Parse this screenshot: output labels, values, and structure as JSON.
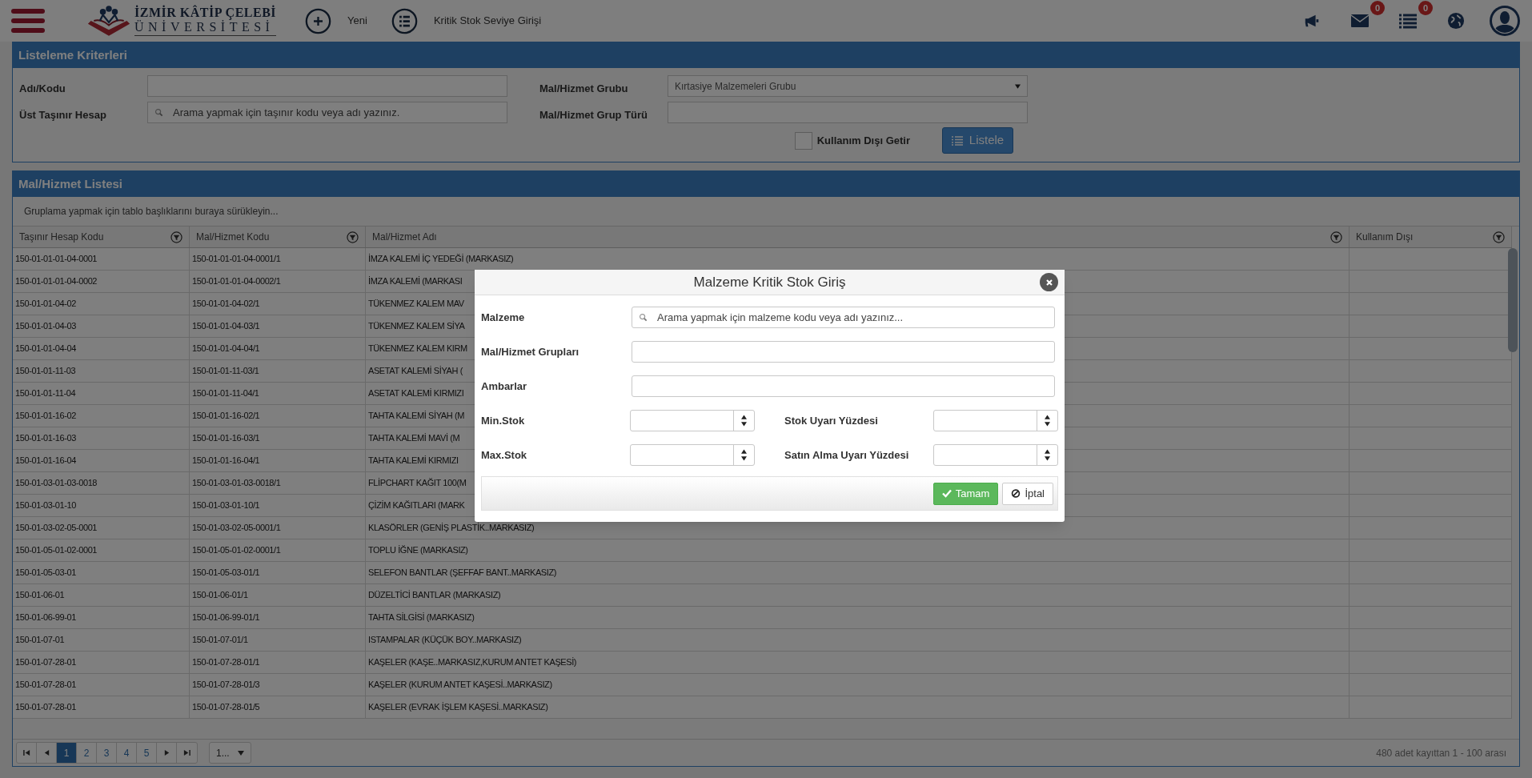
{
  "header": {
    "logo": {
      "line1": "İZMİR KÂTİP ÇELEBİ",
      "line2": "ÜNİVERSİTESİ"
    },
    "nav": [
      {
        "kind": "plus",
        "label": "Yeni"
      },
      {
        "kind": "list",
        "label": "Kritik Stok Seviye Girişi"
      }
    ],
    "tools": [
      {
        "kind": "megaphone"
      },
      {
        "kind": "mail",
        "badge": "0"
      },
      {
        "kind": "tasks",
        "badge": "0"
      },
      {
        "kind": "globe"
      },
      {
        "kind": "avatar"
      }
    ]
  },
  "criteria": {
    "title": "Listeleme Kriterleri",
    "fields": [
      {
        "label": "Adı/Kodu",
        "kind": "text"
      },
      {
        "label": "Mal/Hizmet Grubu",
        "kind": "select",
        "value": "Kırtasiye Malzemeleri Grubu"
      },
      {
        "label": "Üst Taşınır Hesap",
        "kind": "search",
        "placeholder": "Arama yapmak için taşınır kodu veya adı yazınız."
      },
      {
        "label": "Mal/Hizmet Grup Türü",
        "kind": "text"
      }
    ],
    "checkbox": {
      "label": "Kullanım Dışı Getir",
      "checked": false
    },
    "button": "Listele"
  },
  "list": {
    "title": "Mal/Hizmet Listesi",
    "group_hint": "Gruplama yapmak için tablo başlıklarını buraya sürükleyin...",
    "columns": [
      {
        "label": "Taşınır Hesap Kodu",
        "filter": true
      },
      {
        "label": "Mal/Hizmet Kodu",
        "filter": true
      },
      {
        "label": "Mal/Hizmet Adı",
        "filter": true
      },
      {
        "label": "Kullanım Dışı",
        "filter": true
      }
    ],
    "rows": [
      [
        "150-01-01-01-04-0001",
        "150-01-01-01-04-0001/1",
        "İMZA KALEMİ İÇ YEDEĞİ (MARKASIZ)"
      ],
      [
        "150-01-01-01-04-0002",
        "150-01-01-01-04-0002/1",
        "İMZA KALEMİ (MARKASI"
      ],
      [
        "150-01-01-04-02",
        "150-01-01-04-02/1",
        "TÜKENMEZ KALEM MAV"
      ],
      [
        "150-01-01-04-03",
        "150-01-01-04-03/1",
        "TÜKENMEZ KALEM SİYA"
      ],
      [
        "150-01-01-04-04",
        "150-01-01-04-04/1",
        "TÜKENMEZ KALEM KIRM"
      ],
      [
        "150-01-01-11-03",
        "150-01-01-11-03/1",
        "ASETAT KALEMİ SİYAH ("
      ],
      [
        "150-01-01-11-04",
        "150-01-01-11-04/1",
        "ASETAT KALEMİ KIRMIZI"
      ],
      [
        "150-01-01-16-02",
        "150-01-01-16-02/1",
        "TAHTA KALEMİ SİYAH (M"
      ],
      [
        "150-01-01-16-03",
        "150-01-01-16-03/1",
        "TAHTA KALEMİ MAVİ (M"
      ],
      [
        "150-01-01-16-04",
        "150-01-01-16-04/1",
        "TAHTA KALEMİ KIRMIZI"
      ],
      [
        "150-01-03-01-03-0018",
        "150-01-03-01-03-0018/1",
        "FLİPCHART KAĞIT 100(M"
      ],
      [
        "150-01-03-01-10",
        "150-01-03-01-10/1",
        "ÇİZİM KAĞITLARI (MARK"
      ],
      [
        "150-01-03-02-05-0001",
        "150-01-03-02-05-0001/1",
        "KLASÖRLER (GENİŞ PLASTİK..MARKASIZ)"
      ],
      [
        "150-01-05-01-02-0001",
        "150-01-05-01-02-0001/1",
        "TOPLU İĞNE (MARKASIZ)"
      ],
      [
        "150-01-05-03-01",
        "150-01-05-03-01/1",
        "SELEFON BANTLAR (ŞEFFAF BANT..MARKASIZ)"
      ],
      [
        "150-01-06-01",
        "150-01-06-01/1",
        "DÜZELTİCİ BANTLAR (MARKASIZ)"
      ],
      [
        "150-01-06-99-01",
        "150-01-06-99-01/1",
        "TAHTA SİLGİSİ (MARKASIZ)"
      ],
      [
        "150-01-07-01",
        "150-01-07-01/1",
        "ISTAMPALAR (KÜÇÜK BOY..MARKASIZ)"
      ],
      [
        "150-01-07-28-01",
        "150-01-07-28-01/1",
        "KAŞELER (KAŞE..MARKASIZ,KURUM ANTET KAŞESİ)"
      ],
      [
        "150-01-07-28-01",
        "150-01-07-28-01/3",
        "KAŞELER (KURUM ANTET KAŞESİ..MARKASIZ)"
      ],
      [
        "150-01-07-28-01",
        "150-01-07-28-01/5",
        "KAŞELER (EVRAK İŞLEM KAŞESİ..MARKASIZ)"
      ]
    ],
    "pages": [
      {
        "label": "1",
        "selected": true
      },
      {
        "label": "2",
        "selected": false
      },
      {
        "label": "3",
        "selected": false
      },
      {
        "label": "4",
        "selected": false
      },
      {
        "label": "5",
        "selected": false
      }
    ],
    "page_size": "1...",
    "summary": "480 adet kayıttan 1 - 100 arası"
  },
  "dialog": {
    "title": "Malzeme Kritik Stok Giriş",
    "fields": [
      {
        "label": "Malzeme",
        "kind": "search",
        "placeholder": "Arama yapmak için malzeme kodu veya adı yazınız..."
      },
      {
        "label": "Mal/Hizmet Grupları",
        "kind": "text"
      },
      {
        "label": "Ambarlar",
        "kind": "text"
      }
    ],
    "spinner_rows": [
      [
        {
          "label": "Min.Stok"
        },
        {
          "label": "Stok Uyarı Yüzdesi"
        }
      ],
      [
        {
          "label": "Max.Stok"
        },
        {
          "label": "Satın Alma Uyarı Yüzdesi"
        }
      ]
    ],
    "buttons": [
      {
        "label": "Tamam",
        "kind": "primary"
      },
      {
        "label": "İptal",
        "kind": "cancel"
      }
    ]
  }
}
